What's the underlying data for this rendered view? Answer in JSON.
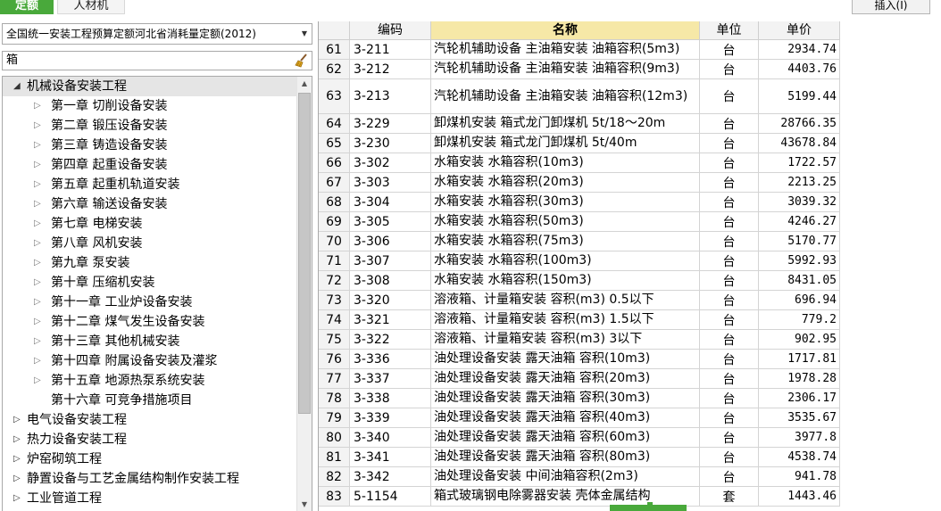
{
  "tabs": [
    "定额",
    "人材机"
  ],
  "insert_button": "插入(I)",
  "left_panel": {
    "library_combo": "全国统一安装工程预算定额河北省消耗量定额(2012)",
    "search_value": "箱",
    "tree": [
      {
        "label": "机械设备安装工程",
        "level": 1,
        "expanded": true,
        "selected": true
      },
      {
        "label": "第一章 切削设备安装",
        "level": 2,
        "has_children": true
      },
      {
        "label": "第二章 锻压设备安装",
        "level": 2,
        "has_children": true
      },
      {
        "label": "第三章 铸造设备安装",
        "level": 2,
        "has_children": true
      },
      {
        "label": "第四章 起重设备安装",
        "level": 2,
        "has_children": true
      },
      {
        "label": "第五章 起重机轨道安装",
        "level": 2,
        "has_children": true
      },
      {
        "label": "第六章 输送设备安装",
        "level": 2,
        "has_children": true
      },
      {
        "label": "第七章 电梯安装",
        "level": 2,
        "has_children": true
      },
      {
        "label": "第八章 风机安装",
        "level": 2,
        "has_children": true
      },
      {
        "label": "第九章 泵安装",
        "level": 2,
        "has_children": true
      },
      {
        "label": "第十章 压缩机安装",
        "level": 2,
        "has_children": true
      },
      {
        "label": "第十一章 工业炉设备安装",
        "level": 2,
        "has_children": true
      },
      {
        "label": "第十二章 煤气发生设备安装",
        "level": 2,
        "has_children": true
      },
      {
        "label": "第十三章 其他机械安装",
        "level": 2,
        "has_children": true
      },
      {
        "label": "第十四章 附属设备安装及灌浆",
        "level": 2,
        "has_children": true
      },
      {
        "label": "第十五章 地源热泵系统安装",
        "level": 2,
        "has_children": true
      },
      {
        "label": "第十六章 可竞争措施项目",
        "level": 2,
        "has_children": false
      },
      {
        "label": "电气设备安装工程",
        "level": 1,
        "expanded": false
      },
      {
        "label": "热力设备安装工程",
        "level": 1,
        "expanded": false
      },
      {
        "label": "炉窑砌筑工程",
        "level": 1,
        "expanded": false
      },
      {
        "label": "静置设备与工艺金属结构制作安装工程",
        "level": 1,
        "expanded": false
      },
      {
        "label": "工业管道工程",
        "level": 1,
        "expanded": false
      }
    ]
  },
  "grid": {
    "columns": [
      "",
      "编码",
      "名称",
      "单位",
      "单价"
    ],
    "rows": [
      {
        "no": "61",
        "code": "3-211",
        "name": "汽轮机辅助设备 主油箱安装 油箱容积(5m3)",
        "unit": "台",
        "price": "2934.74"
      },
      {
        "no": "62",
        "code": "3-212",
        "name": "汽轮机辅助设备 主油箱安装 油箱容积(9m3)",
        "unit": "台",
        "price": "4403.76"
      },
      {
        "no": "63",
        "code": "3-213",
        "name": "汽轮机辅助设备 主油箱安装 油箱容积(12m3)",
        "unit": "台",
        "price": "5199.44"
      },
      {
        "no": "64",
        "code": "3-229",
        "name": "卸煤机安装 箱式龙门卸煤机 5t/18～20m",
        "unit": "台",
        "price": "28766.35"
      },
      {
        "no": "65",
        "code": "3-230",
        "name": "卸煤机安装 箱式龙门卸煤机 5t/40m",
        "unit": "台",
        "price": "43678.84"
      },
      {
        "no": "66",
        "code": "3-302",
        "name": "水箱安装 水箱容积(10m3)",
        "unit": "台",
        "price": "1722.57"
      },
      {
        "no": "67",
        "code": "3-303",
        "name": "水箱安装 水箱容积(20m3)",
        "unit": "台",
        "price": "2213.25"
      },
      {
        "no": "68",
        "code": "3-304",
        "name": "水箱安装 水箱容积(30m3)",
        "unit": "台",
        "price": "3039.32"
      },
      {
        "no": "69",
        "code": "3-305",
        "name": "水箱安装 水箱容积(50m3)",
        "unit": "台",
        "price": "4246.27"
      },
      {
        "no": "70",
        "code": "3-306",
        "name": "水箱安装 水箱容积(75m3)",
        "unit": "台",
        "price": "5170.77"
      },
      {
        "no": "71",
        "code": "3-307",
        "name": "水箱安装 水箱容积(100m3)",
        "unit": "台",
        "price": "5992.93"
      },
      {
        "no": "72",
        "code": "3-308",
        "name": "水箱安装 水箱容积(150m3)",
        "unit": "台",
        "price": "8431.05"
      },
      {
        "no": "73",
        "code": "3-320",
        "name": "溶液箱、计量箱安装 容积(m3) 0.5以下",
        "unit": "台",
        "price": "696.94"
      },
      {
        "no": "74",
        "code": "3-321",
        "name": "溶液箱、计量箱安装 容积(m3) 1.5以下",
        "unit": "台",
        "price": "779.2"
      },
      {
        "no": "75",
        "code": "3-322",
        "name": "溶液箱、计量箱安装 容积(m3) 3以下",
        "unit": "台",
        "price": "902.95"
      },
      {
        "no": "76",
        "code": "3-336",
        "name": "油处理设备安装 露天油箱 容积(10m3)",
        "unit": "台",
        "price": "1717.81"
      },
      {
        "no": "77",
        "code": "3-337",
        "name": "油处理设备安装 露天油箱 容积(20m3)",
        "unit": "台",
        "price": "1978.28"
      },
      {
        "no": "78",
        "code": "3-338",
        "name": "油处理设备安装 露天油箱 容积(30m3)",
        "unit": "台",
        "price": "2306.17"
      },
      {
        "no": "79",
        "code": "3-339",
        "name": "油处理设备安装 露天油箱 容积(40m3)",
        "unit": "台",
        "price": "3535.67"
      },
      {
        "no": "80",
        "code": "3-340",
        "name": "油处理设备安装 露天油箱 容积(60m3)",
        "unit": "台",
        "price": "3977.8"
      },
      {
        "no": "81",
        "code": "3-341",
        "name": "油处理设备安装 露天油箱 容积(80m3)",
        "unit": "台",
        "price": "4538.74"
      },
      {
        "no": "82",
        "code": "3-342",
        "name": "油处理设备安装 中间油箱容积(2m3)",
        "unit": "台",
        "price": "941.78"
      },
      {
        "no": "83",
        "code": "5-1154",
        "name": "箱式玻璃钢电除雾器安装 壳体金属结构",
        "unit": "套",
        "price": "1443.46"
      }
    ]
  },
  "colors": {
    "accent_green": "#49a93b",
    "sorted_header": "#f6e8a7"
  }
}
